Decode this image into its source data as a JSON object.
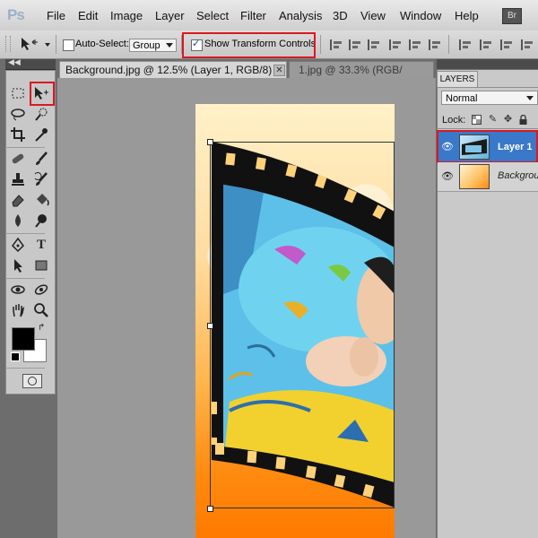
{
  "app": {
    "logo": "Ps",
    "bridge_badge": "Br"
  },
  "menu": [
    "File",
    "Edit",
    "Image",
    "Layer",
    "Select",
    "Filter",
    "Analysis",
    "3D",
    "View",
    "Window",
    "Help"
  ],
  "options": {
    "auto_select_label": "Auto-Select:",
    "auto_select_checked": false,
    "auto_select_value": "Group",
    "show_transform_label": "Show Transform Controls",
    "show_transform_checked": true
  },
  "tabs": [
    {
      "label": "Background.jpg @ 12.5% (Layer 1, RGB/8) *",
      "active": true,
      "close": "✕"
    },
    {
      "label": "1.jpg @ 33.3% (RGB/",
      "active": false
    }
  ],
  "layers_panel": {
    "title": "LAYERS",
    "blend_mode": "Normal",
    "lock_label": "Lock:",
    "layers": [
      {
        "name": "Layer 1",
        "visible": true,
        "selected": true
      },
      {
        "name": "Background",
        "visible": true,
        "selected": false
      }
    ]
  },
  "colors": {
    "highlight": "#d9191f",
    "selection": "#3a78c9",
    "foreground": "#000000",
    "background": "#ffffff"
  },
  "icons": {
    "move_tool": "move-icon",
    "marquee_tool": "marquee-icon",
    "lasso_tool": "lasso-icon",
    "crop_tool": "crop-icon",
    "eyedropper_tool": "eyedropper-icon",
    "healing_tool": "healing-brush-icon",
    "brush_tool": "brush-icon",
    "stamp_tool": "clone-stamp-icon",
    "history_brush_tool": "history-brush-icon",
    "eraser_tool": "eraser-icon",
    "bucket_tool": "paint-bucket-icon",
    "blur_tool": "blur-icon",
    "dodge_tool": "dodge-icon",
    "pen_tool": "pen-icon",
    "type_tool": "type-icon",
    "path_selection_tool": "path-selection-icon",
    "shape_tool": "rectangle-icon",
    "3d_rotate_tool": "3d-rotate-icon",
    "3d_orbit_tool": "3d-orbit-icon",
    "hand_tool": "hand-icon",
    "zoom_tool": "zoom-icon",
    "eye": "eye-icon"
  }
}
